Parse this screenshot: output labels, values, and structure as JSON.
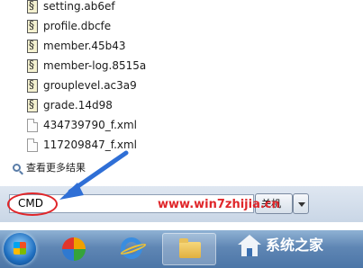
{
  "results": [
    {
      "name": "setting.ab6ef",
      "icon": "script-file-icon"
    },
    {
      "name": "profile.dbcfe",
      "icon": "script-file-icon"
    },
    {
      "name": "member.45b43",
      "icon": "script-file-icon"
    },
    {
      "name": "member-log.8515a",
      "icon": "script-file-icon"
    },
    {
      "name": "grouplevel.ac3a9",
      "icon": "script-file-icon"
    },
    {
      "name": "grade.14d98",
      "icon": "script-file-icon"
    },
    {
      "name": "434739790_f.xml",
      "icon": "xml-file-icon"
    },
    {
      "name": "117209847_f.xml",
      "icon": "xml-file-icon"
    }
  ],
  "see_more": "查看更多结果",
  "search": {
    "value": "CMD"
  },
  "shutdown": {
    "label": "关机"
  },
  "watermark": {
    "url": "www.win7zhijia.cn",
    "brand": "系统之家"
  },
  "colors": {
    "annotation": "#e0262a",
    "arrow": "#2f6fd6",
    "taskbar": "#5f86b4"
  }
}
